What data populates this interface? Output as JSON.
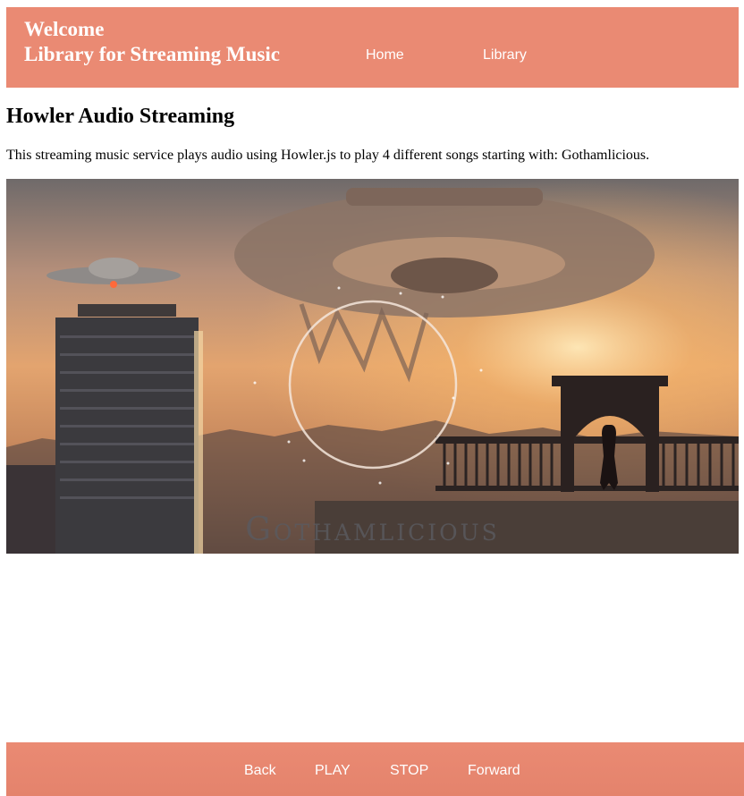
{
  "header": {
    "welcome": "Welcome",
    "brand": "Library for Streaming Music",
    "nav": {
      "home": "Home",
      "library": "Library"
    }
  },
  "main": {
    "title": "Howler Audio Streaming",
    "intro": "This streaming music service plays audio using Howler.js to play 4 different songs starting with: Gothamlicious.",
    "cover_caption": "Gothamlicious"
  },
  "controls": {
    "back": "Back",
    "play": "PLAY",
    "stop": "STOP",
    "forward": "Forward"
  },
  "colors": {
    "accent": "#ea8a73",
    "text_on_accent": "#ffffff"
  }
}
